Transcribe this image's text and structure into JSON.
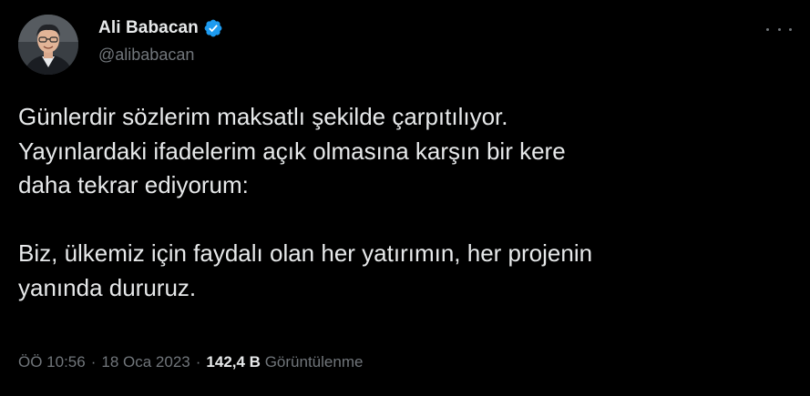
{
  "author": {
    "display_name": "Ali Babacan",
    "handle": "@alibabacan",
    "verified": true,
    "verified_color": "#1d9bf0"
  },
  "tweet": {
    "paragraph_1": "Günlerdir sözlerim maksatlı şekilde çarpıtılıyor.\nYayınlardaki ifadelerim açık olmasına karşın bir kere\ndaha tekrar ediyorum:",
    "paragraph_2": "Biz, ülkemiz için faydalı olan her yatırımın, her projenin\nyanında dururuz."
  },
  "meta": {
    "time": "ÖÖ 10:56",
    "separator_1": "·",
    "date": "18 Oca 2023",
    "separator_2": "·",
    "views_count": "142,4 B",
    "views_label": "Görüntülenme"
  },
  "icons": {
    "verified": "verified-badge-icon",
    "more": "more-horizontal-icon",
    "avatar": "avatar-photo"
  },
  "colors": {
    "background": "#000000",
    "text_primary": "#e7e9ea",
    "text_secondary": "#71767b",
    "accent": "#1d9bf0"
  }
}
